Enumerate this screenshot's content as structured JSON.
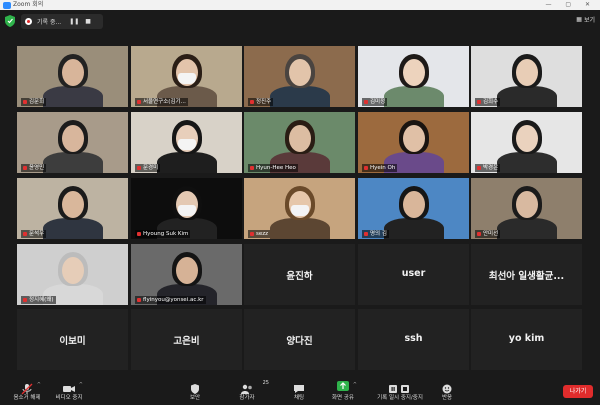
{
  "window": {
    "title": "Zoom 회의"
  },
  "topbar": {
    "recording_label": "기록 중...",
    "pause_icon": "pause-icon",
    "stop_icon": "stop-icon",
    "view_label": "보기"
  },
  "tiles": [
    {
      "name": "김문희",
      "type": "video",
      "bg": "#9a8e7a",
      "shirt": "#3a3a44",
      "hair": "#222",
      "skin": "#d8b59a"
    },
    {
      "name": "서울연구소(김기...",
      "type": "video",
      "bg": "#b8a98e",
      "shirt": "#6b5a4a",
      "hair": "#2a1e16",
      "skin": "#e3c4ab",
      "mask": true
    },
    {
      "name": "정진주",
      "type": "video",
      "bg": "#8c6b4d",
      "shirt": "#2b3a4a",
      "hair": "#4a4440",
      "skin": "#e2c4aa",
      "active": true
    },
    {
      "name": "김미정",
      "type": "video",
      "bg": "#e4e6ea",
      "shirt": "#6c8a6c",
      "hair": "#1e1a18",
      "skin": "#edd3bd"
    },
    {
      "name": "김희수",
      "type": "video",
      "bg": "#dedede",
      "shirt": "#2a2a2a",
      "hair": "#1a1a1a",
      "skin": "#e8cdb6"
    },
    {
      "name": "윤영민",
      "type": "video",
      "bg": "#a89b8a",
      "shirt": "#3d3d3d",
      "hair": "#1c1c1c",
      "skin": "#d8b69c"
    },
    {
      "name": "문경미",
      "type": "video",
      "bg": "#d8d2c8",
      "shirt": "#1e1e1e",
      "hair": "#161616",
      "skin": "#e8cfbb",
      "mask": true
    },
    {
      "name": "Hyun-Hee Heo",
      "type": "video",
      "bg": "#6b8a6a",
      "shirt": "#5a3a3a",
      "hair": "#2a1d14",
      "skin": "#dcbda2"
    },
    {
      "name": "Hyein Oh",
      "type": "video",
      "bg": "#9c6a3e",
      "shirt": "#6a4a8a",
      "hair": "#1a1410",
      "skin": "#e0c0a6"
    },
    {
      "name": "박경은",
      "type": "video",
      "bg": "#e6e6e6",
      "shirt": "#2d2d2d",
      "hair": "#1a1a1a",
      "skin": "#ead2be"
    },
    {
      "name": "문석우",
      "type": "video",
      "bg": "#bdb3a2",
      "shirt": "#2f3540",
      "hair": "#1b1b1b",
      "skin": "#d9b79b"
    },
    {
      "name": "Hyoung Suk Kim",
      "type": "video",
      "bg": "#0d0d0d",
      "shirt": "#222",
      "hair": "#0f0f0f",
      "skin": "#e4c9b3",
      "mask": true
    },
    {
      "name": "sezz",
      "type": "video",
      "bg": "#c6a47e",
      "shirt": "#5c4632",
      "hair": "#6a4a2a",
      "skin": "#e6c7aa",
      "mask": true
    },
    {
      "name": "명의 김",
      "type": "video",
      "bg": "#4d87c4",
      "shirt": "#222",
      "hair": "#161616",
      "skin": "#d9b69a"
    },
    {
      "name": "안미선",
      "type": "video",
      "bg": "#8e7f6c",
      "shirt": "#2a2a2a",
      "hair": "#1b1b1b",
      "skin": "#d8b9a0"
    },
    {
      "name": "정지혜(왜)",
      "type": "video",
      "bg": "#cfcfcf",
      "shirt": "#d8d8d8",
      "hair": "#bcbcbc",
      "skin": "#e6cdb8"
    },
    {
      "name": "flyinyou@yonsei.ac.kr",
      "type": "video",
      "bg": "#6a6a6a",
      "shirt": "#24242a",
      "hair": "#141414",
      "skin": "#d6b296"
    },
    {
      "name": "윤진하",
      "type": "name"
    },
    {
      "name": "user",
      "type": "name"
    },
    {
      "name": "최선아 일생활균...",
      "type": "name"
    },
    {
      "name": "이보미",
      "type": "name"
    },
    {
      "name": "고은비",
      "type": "name"
    },
    {
      "name": "양다진",
      "type": "name"
    },
    {
      "name": "ssh",
      "type": "name"
    },
    {
      "name": "yo kim",
      "type": "name"
    }
  ],
  "toolbar": {
    "unmute": "음소거 해제",
    "stop_video": "비디오 중지",
    "security": "보안",
    "participants": "참가자",
    "participants_count": "25",
    "chat": "채팅",
    "share_screen": "화면 공유",
    "pause_stop_recording": "기록 일시 중지/중지",
    "reactions": "반응",
    "leave": "나가기"
  },
  "colors": {
    "active_speaker": "#c9dc3a",
    "leave_button": "#e02c2c",
    "share_green": "#2fb34b"
  }
}
